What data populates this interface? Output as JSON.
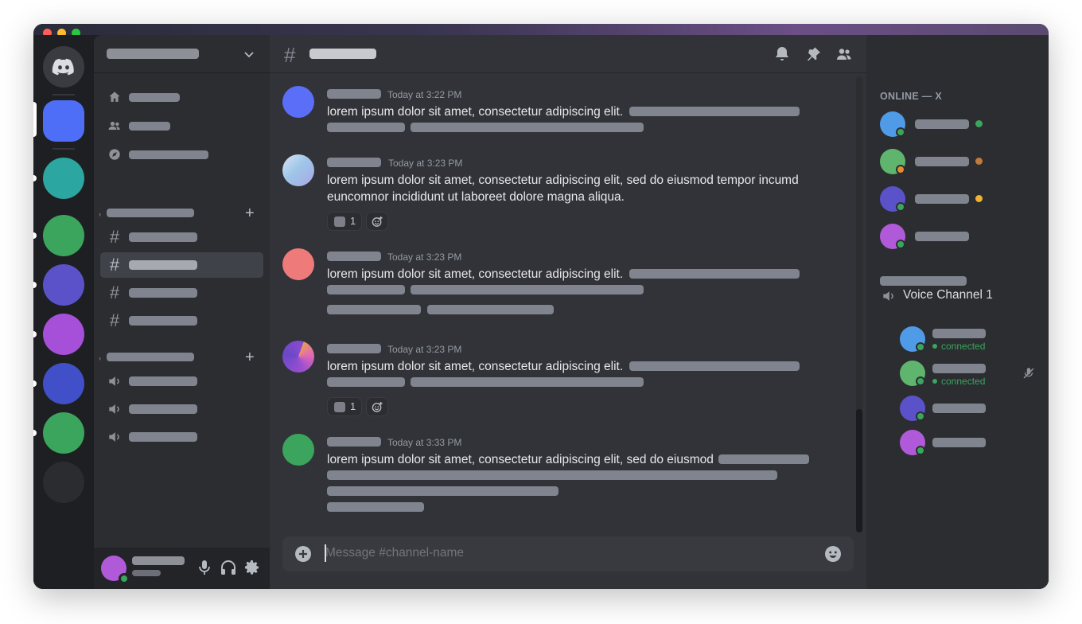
{
  "window": {
    "title": "Discord"
  },
  "rail": {
    "servers": [
      {
        "name": "home",
        "color": "#5865f2"
      },
      {
        "name": "server-1",
        "color": "#4f6ef7"
      },
      {
        "name": "server-2",
        "color": "#2ba6a0"
      },
      {
        "name": "server-3",
        "color": "#3ba55d"
      },
      {
        "name": "server-4",
        "color": "#5b52c9"
      },
      {
        "name": "server-5",
        "color": "#a64fd9"
      },
      {
        "name": "server-6",
        "color": "#4150c8"
      },
      {
        "name": "server-7",
        "color": "#3ba55d"
      },
      {
        "name": "server-8",
        "color": "#2b2c30"
      }
    ]
  },
  "sidebar": {
    "nav_items": [
      {
        "icon": "home-icon"
      },
      {
        "icon": "friends-icon"
      },
      {
        "icon": "compass-icon"
      }
    ],
    "text_channels": [
      {
        "icon": "hash-icon",
        "active": false
      },
      {
        "icon": "hash-icon",
        "active": true
      },
      {
        "icon": "hash-icon",
        "active": false
      },
      {
        "icon": "hash-icon",
        "active": false
      }
    ],
    "voice_channels": [
      {
        "icon": "speaker-icon"
      },
      {
        "icon": "speaker-icon"
      },
      {
        "icon": "speaker-icon"
      }
    ]
  },
  "chat": {
    "messages": [
      {
        "time": "Today at 3:22 PM",
        "text": "lorem ipsum dolor sit amet, consectetur adipiscing elit.",
        "avatar_color": "#5865f2"
      },
      {
        "time": "Today at 3:23 PM",
        "text": "lorem ipsum dolor sit amet, consectetur adipiscing elit, sed do eiusmod tempor incumd",
        "text2": "euncomnor incididunt ut laboreet dolore magna aliqua.",
        "reaction_count": "1",
        "avatar_color": "#9fc6e8"
      },
      {
        "time": "Today at 3:23 PM",
        "text": "lorem ipsum dolor sit amet, consectetur adipiscing elit.",
        "avatar_color": "#ee7a7a"
      },
      {
        "time": "Today at 3:23 PM",
        "text": "lorem ipsum dolor sit amet, consectetur adipiscing elit.",
        "reaction_count": "1",
        "avatar_color": "#8a4bd0"
      },
      {
        "time": "Today at 3:33 PM",
        "text": "lorem ipsum dolor sit amet, consectetur adipiscing elit, sed do eiusmod",
        "avatar_color": "#3ba55d"
      }
    ],
    "composer": {
      "placeholder": "Message #channel-name"
    }
  },
  "members": {
    "online_heading": "ONLINE — X",
    "online": [
      {
        "avatar_color": "#4f9be8",
        "status": "#3ba55d",
        "dot": "#3ba55d"
      },
      {
        "avatar_color": "#5fb56e",
        "status": "#e98b2a",
        "dot": "#c27a3a"
      },
      {
        "avatar_color": "#5b52c9",
        "status": "#3ba55d",
        "dot": "#f0b232"
      },
      {
        "avatar_color": "#b15ad9",
        "status": "#3ba55d"
      }
    ],
    "voice_channel": {
      "name": "Voice Channel 1",
      "participants": [
        {
          "avatar_color": "#4f9be8",
          "status_text": "connected"
        },
        {
          "avatar_color": "#5fb56e",
          "status_text": "connected",
          "muted": true
        },
        {
          "avatar_color": "#5b52c9"
        },
        {
          "avatar_color": "#b15ad9"
        }
      ]
    }
  }
}
